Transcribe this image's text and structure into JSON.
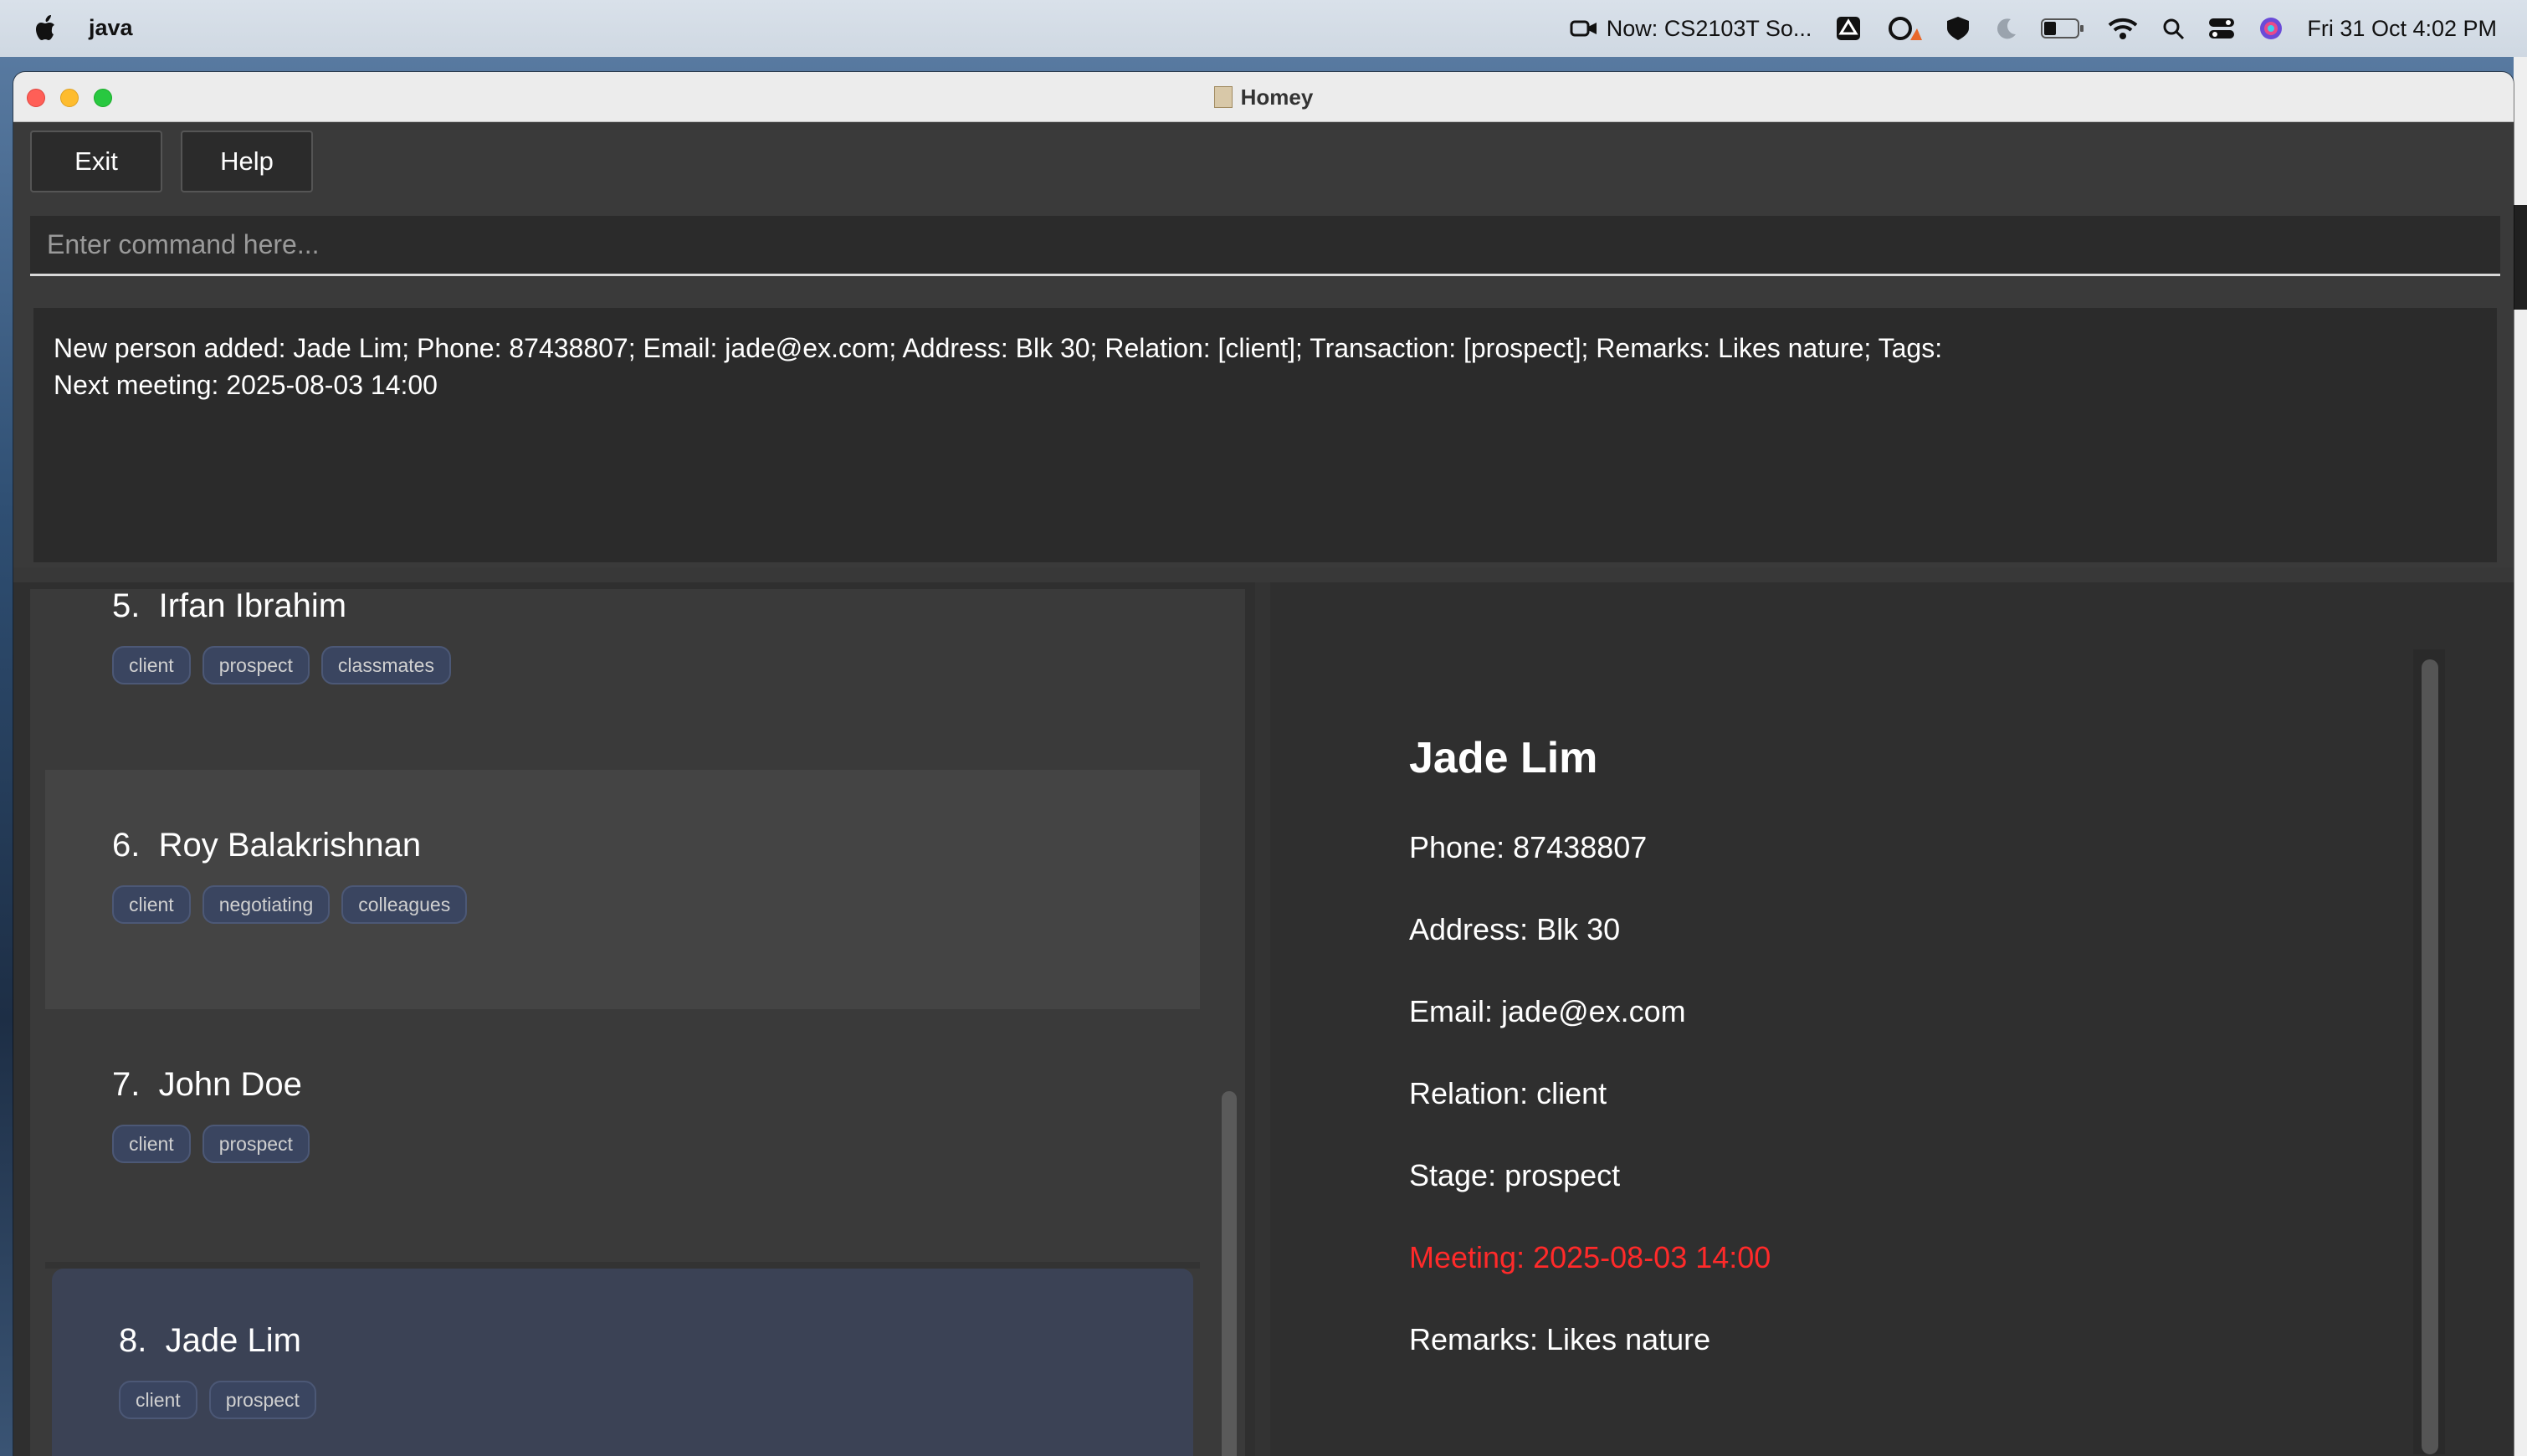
{
  "menubar": {
    "app_name": "java",
    "now_playing": "Now: CS2103T So...",
    "datetime": "Fri 31 Oct  4:02 PM"
  },
  "window": {
    "title": "Homey"
  },
  "toolbar": {
    "exit_label": "Exit",
    "help_label": "Help"
  },
  "command": {
    "placeholder": "Enter command here...",
    "value": ""
  },
  "result": {
    "line1": "New person added: Jade Lim; Phone: 87438807; Email: jade@ex.com; Address: Blk 30; Relation: [client]; Transaction: [prospect]; Remarks: Likes nature; Tags:",
    "line2": "Next meeting: 2025-08-03 14:00"
  },
  "persons": [
    {
      "index": "5.",
      "name": "Irfan Ibrahim",
      "tags": [
        "client",
        "prospect",
        "classmates"
      ]
    },
    {
      "index": "6.",
      "name": "Roy Balakrishnan",
      "tags": [
        "client",
        "negotiating",
        "colleagues"
      ]
    },
    {
      "index": "7.",
      "name": "John Doe",
      "tags": [
        "client",
        "prospect"
      ]
    },
    {
      "index": "8.",
      "name": "Jade Lim",
      "tags": [
        "client",
        "prospect"
      ]
    }
  ],
  "detail": {
    "name": "Jade Lim",
    "phone": "Phone: 87438807",
    "address": "Address: Blk 30",
    "email": "Email: jade@ex.com",
    "relation": "Relation: client",
    "stage": "Stage: prospect",
    "meeting": "Meeting: 2025-08-03 14:00",
    "remarks": "Remarks: Likes nature",
    "meeting_color": "#ff2a2a"
  }
}
